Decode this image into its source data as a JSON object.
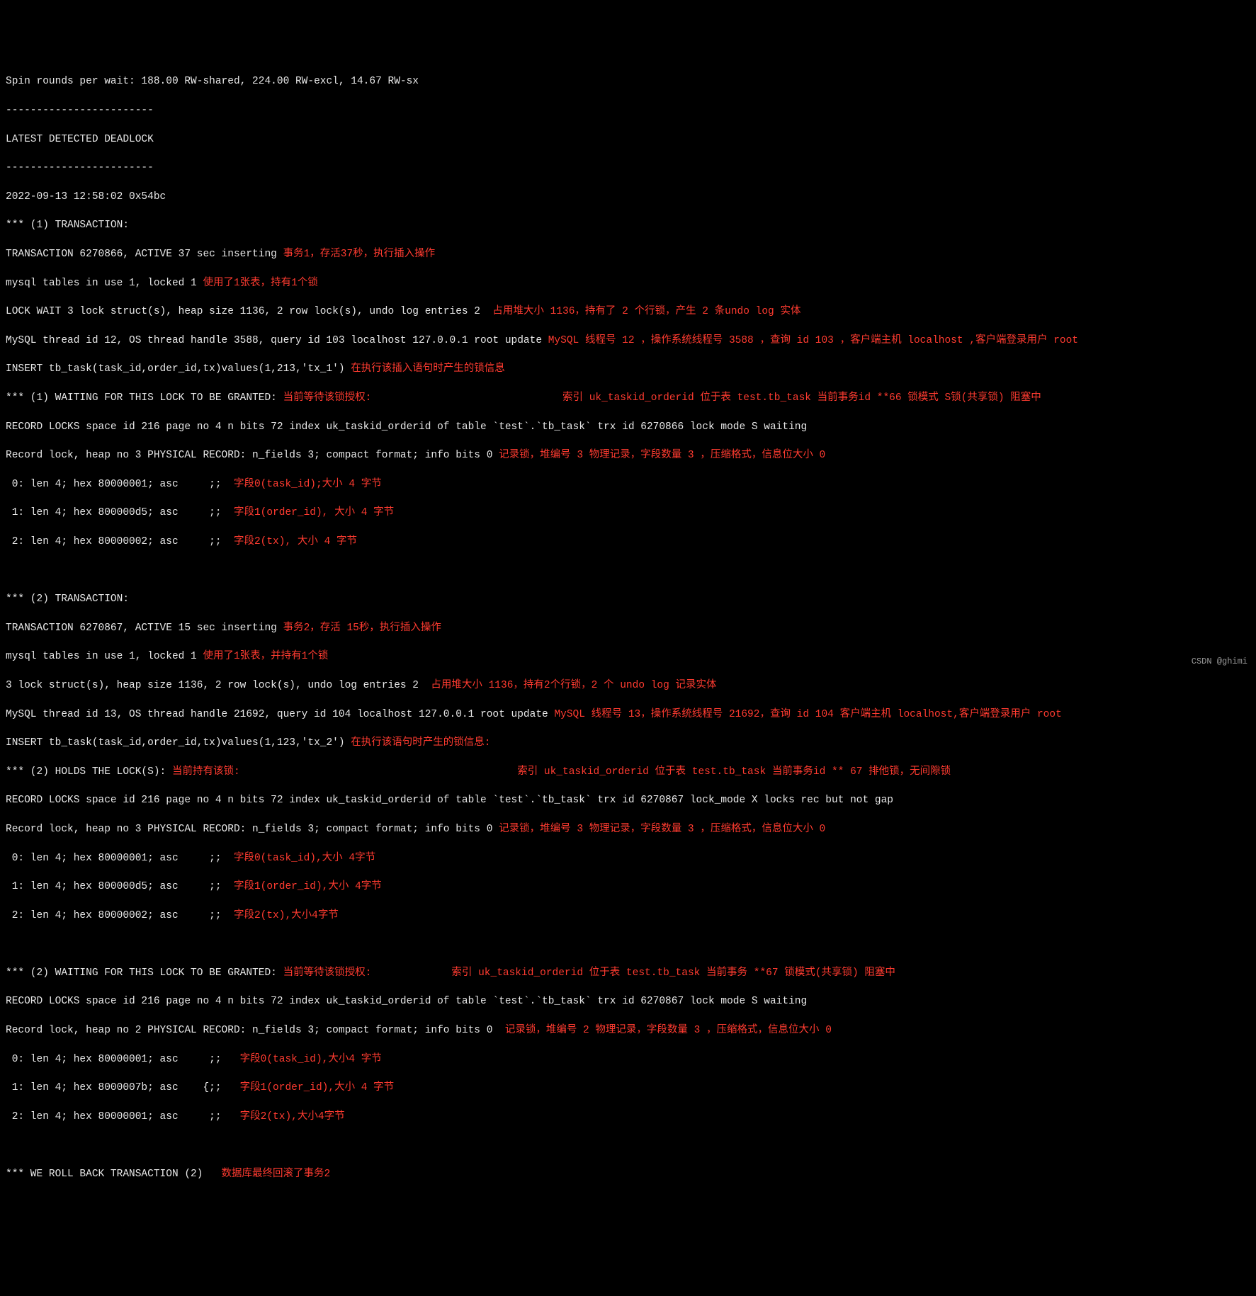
{
  "watermark": "CSDN @ghimi",
  "header": {
    "spin": "Spin rounds per wait: 188.00 RW-shared, 224.00 RW-excl, 14.67 RW-sx",
    "dash1": "------------------------",
    "title": "LATEST DETECTED DEADLOCK",
    "dash2": "------------------------",
    "ts": "2022-09-13 12:58:02 0x54bc"
  },
  "t1": {
    "hdr": "*** (1) TRANSACTION:",
    "line1": "TRANSACTION 6270866, ACTIVE 37 sec inserting ",
    "ann1": "事务1，存活37秒，执行插入操作",
    "line2": "mysql tables in use 1, locked 1 ",
    "ann2": "使用了1张表，持有1个锁",
    "line3": "LOCK WAIT 3 lock struct(s), heap size 1136, 2 row lock(s), undo log entries 2  ",
    "ann3": "占用堆大小 1136，持有了 2 个行锁，产生 2 条undo log 实体",
    "line4": "MySQL thread id 12, OS thread handle 3588, query id 103 localhost 127.0.0.1 root update ",
    "ann4": "MySQL 线程号 12 ，操作系统线程号 3588 ，查询 id 103 ，客户端主机 localhost ,客户端登录用户 root",
    "line5": "INSERT tb_task(task_id,order_id,tx)values(1,213,'tx_1') ",
    "ann5": "在执行该插入语句时产生的锁信息",
    "wait_hdr": "*** (1) WAITING FOR THIS LOCK TO BE GRANTED: ",
    "wait_ann_left": "当前等待该锁授权:",
    "wait_ann_right": "                               索引 uk_taskid_orderid 位于表 test.tb_task 当前事务id **66 锁模式 S锁(共享锁) 阻塞中",
    "rec1": "RECORD LOCKS space id 216 page no 4 n bits 72 index uk_taskid_orderid of table `test`.`tb_task` trx id 6270866 lock mode S waiting",
    "rec2": "Record lock, heap no 3 PHYSICAL RECORD: n_fields 3; compact format; info bits 0 ",
    "rec2_ann": "记录锁，堆编号 3 物理记录，字段数量 3 ，压缩格式，信息位大小 0",
    "f0": " 0: len 4; hex 80000001; asc     ;;  ",
    "f0a": "字段0(task_id);大小 4 字节",
    "f1": " 1: len 4; hex 800000d5; asc     ;;  ",
    "f1a": "字段1(order_id), 大小 4 字节",
    "f2": " 2: len 4; hex 80000002; asc     ;;  ",
    "f2a": "字段2(tx), 大小 4 字节"
  },
  "t2": {
    "hdr": "*** (2) TRANSACTION:",
    "line1": "TRANSACTION 6270867, ACTIVE 15 sec inserting ",
    "ann1": "事务2，存活 15秒，执行插入操作",
    "line2": "mysql tables in use 1, locked 1 ",
    "ann2": "使用了1张表，并持有1个锁",
    "line3": "3 lock struct(s), heap size 1136, 2 row lock(s), undo log entries 2  ",
    "ann3": "占用堆大小 1136，持有2个行锁，2 个 undo log 记录实体",
    "line4": "MySQL thread id 13, OS thread handle 21692, query id 104 localhost 127.0.0.1 root update ",
    "ann4": "MySQL 线程号 13，操作系统线程号 21692，查询 id 104 客户端主机 localhost,客户端登录用户 root",
    "line5": "INSERT tb_task(task_id,order_id,tx)values(1,123,'tx_2') ",
    "ann5": "在执行该语句时产生的锁信息:",
    "holds_hdr": "*** (2) HOLDS THE LOCK(S): ",
    "holds_ann_left": "当前持有该锁:",
    "holds_ann_right": "                                             索引 uk_taskid_orderid 位于表 test.tb_task 当前事务id ** 67 排他锁，无间隙锁",
    "hrec1": "RECORD LOCKS space id 216 page no 4 n bits 72 index uk_taskid_orderid of table `test`.`tb_task` trx id 6270867 lock_mode X locks rec but not gap",
    "hrec2": "Record lock, heap no 3 PHYSICAL RECORD: n_fields 3; compact format; info bits 0 ",
    "hrec2_ann": "记录锁，堆编号 3 物理记录，字段数量 3 ，压缩格式，信息位大小 0",
    "hf0": " 0: len 4; hex 80000001; asc     ;;  ",
    "hf0a": "字段0(task_id),大小 4字节",
    "hf1": " 1: len 4; hex 800000d5; asc     ;;  ",
    "hf1a": "字段1(order_id),大小 4字节",
    "hf2": " 2: len 4; hex 80000002; asc     ;;  ",
    "hf2a": "字段2(tx),大小4字节",
    "wait_hdr": "*** (2) WAITING FOR THIS LOCK TO BE GRANTED: ",
    "wait_ann_left": "当前等待该锁授权:",
    "wait_ann_right": "             索引 uk_taskid_orderid 位于表 test.tb_task 当前事务 **67 锁模式(共享锁) 阻塞中",
    "wrec1": "RECORD LOCKS space id 216 page no 4 n bits 72 index uk_taskid_orderid of table `test`.`tb_task` trx id 6270867 lock mode S waiting",
    "wrec2": "Record lock, heap no 2 PHYSICAL RECORD: n_fields 3; compact format; info bits 0  ",
    "wrec2_ann": "记录锁，堆编号 2 物理记录，字段数量 3 ，压缩格式，信息位大小 0",
    "wf0": " 0: len 4; hex 80000001; asc     ;;   ",
    "wf0a": "字段0(task_id),大小4 字节",
    "wf1": " 1: len 4; hex 8000007b; asc    {;;   ",
    "wf1a": "字段1(order_id),大小 4 字节",
    "wf2": " 2: len 4; hex 80000001; asc     ;;   ",
    "wf2a": "字段2(tx),大小4字节"
  },
  "rollback": {
    "line": "*** WE ROLL BACK TRANSACTION (2)   ",
    "ann": "数据库最终回滚了事务2"
  }
}
